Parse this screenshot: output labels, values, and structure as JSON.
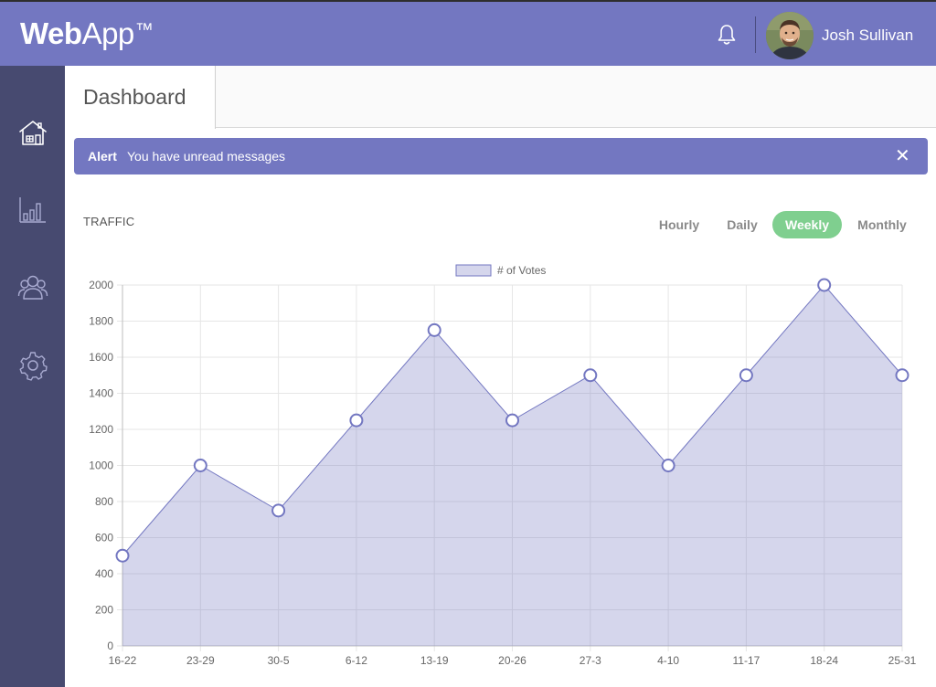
{
  "header": {
    "logo_bold": "Web",
    "logo_regular": "App",
    "logo_tm": "™",
    "user_name": "Josh Sullivan"
  },
  "sidebar": {
    "items": [
      {
        "icon": "home-icon"
      },
      {
        "icon": "bar-chart-icon"
      },
      {
        "icon": "users-icon"
      },
      {
        "icon": "gear-icon"
      }
    ]
  },
  "tabs": [
    {
      "label": "Dashboard",
      "active": true
    }
  ],
  "alert": {
    "title": "Alert",
    "message": "You have unread messages",
    "close": "✕"
  },
  "traffic": {
    "title": "TRAFFIC",
    "ranges": [
      {
        "label": "Hourly",
        "active": false
      },
      {
        "label": "Daily",
        "active": false
      },
      {
        "label": "Weekly",
        "active": true
      },
      {
        "label": "Monthly",
        "active": false
      }
    ]
  },
  "colors": {
    "brand": "#7377c1",
    "sidebar": "#474a70",
    "active_pill": "#7fcf8f",
    "series_fill": "#d5d6eb",
    "series_line": "#7377c1"
  },
  "chart_data": {
    "type": "area",
    "categories": [
      "16-22",
      "23-29",
      "30-5",
      "6-12",
      "13-19",
      "20-26",
      "27-3",
      "4-10",
      "11-17",
      "18-24",
      "25-31"
    ],
    "series": [
      {
        "name": "# of Votes",
        "values": [
          500,
          1000,
          750,
          1250,
          1750,
          1250,
          1500,
          1000,
          1500,
          2000,
          1500
        ]
      }
    ],
    "yticks": [
      0,
      200,
      400,
      600,
      800,
      1000,
      1200,
      1400,
      1600,
      1800,
      2000
    ],
    "ylim": [
      0,
      2000
    ],
    "grid": true,
    "legend": "top-center"
  }
}
